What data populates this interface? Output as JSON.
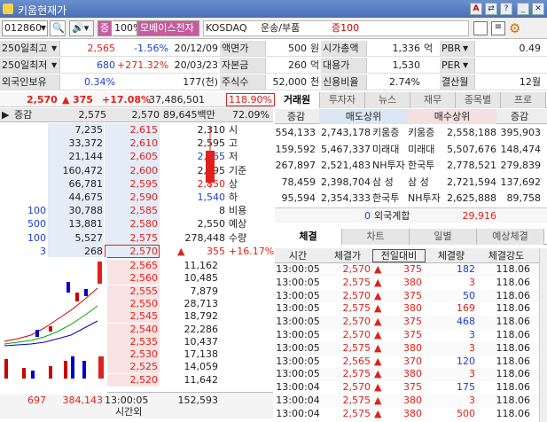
{
  "window": {
    "title": "키움현재가"
  },
  "toolbar": {
    "code": "012860",
    "pct": "100%",
    "name": "모베이스전자",
    "market": "KOSDAQ",
    "sector": "운송/부품",
    "margin": "증100",
    "margin_icon": "증"
  },
  "summary": [
    {
      "label": "250일최고",
      "v1": "2,565",
      "v2": "-1.56%",
      "v3": "20/12/09",
      "k2": "액면가",
      "v4": "500",
      "u4": "원",
      "k3": "시가총액",
      "v5": "1,336",
      "u5": "억",
      "k4": "PBR",
      "v6": "0.49"
    },
    {
      "label": "250일최저",
      "v1": "680",
      "v2": "+271.32%",
      "v3": "20/03/23",
      "k2": "자본금",
      "v4": "260",
      "u4": "억",
      "k3": "대용가",
      "v5": "1,530",
      "u5": "",
      "k4": "PER",
      "v6": ""
    },
    {
      "label": "외국인보유",
      "v1": "0.34%",
      "v2": "",
      "v3": "177(천)",
      "k2": "주식수",
      "v4": "52,000",
      "u4": "천",
      "k3": "신용비율",
      "v5": "2.74%",
      "u5": "",
      "k4": "결산월",
      "v6": "12월"
    }
  ],
  "price": {
    "cur": "2,570",
    "chg": "375",
    "rate": "+17.08%",
    "vol": "37,486,501",
    "ratio": "118.90%"
  },
  "ob_head": {
    "a": "증감",
    "b": "2,575",
    "c": "2,570",
    "d": "89,645백만",
    "e": "72.09%"
  },
  "asks": [
    {
      "q": "7,235",
      "p": "2,615",
      "i": "2,310",
      "il": "시"
    },
    {
      "q": "33,372",
      "p": "2,610",
      "i": "2,595",
      "il": "고"
    },
    {
      "q": "21,144",
      "p": "2,605",
      "i": "2,165",
      "il": "저"
    },
    {
      "q": "160,472",
      "p": "2,600",
      "i": "2,195",
      "il": "기준"
    },
    {
      "q": "66,781",
      "p": "2,595",
      "i": "2,850",
      "il": "상"
    },
    {
      "q": "44,675",
      "p": "2,590",
      "i": "1,540",
      "il": "하"
    },
    {
      "ch": "100",
      "q": "30,788",
      "p": "2,585",
      "i": "8",
      "il": "비용"
    },
    {
      "ch": "500",
      "q": "13,881",
      "p": "2,580",
      "i": "2,550",
      "il": "예상"
    },
    {
      "ch": "100",
      "q": "5,527",
      "p": "2,575",
      "i": "278,448",
      "il": "수량"
    },
    {
      "ch": "3",
      "q": "268",
      "p": "2,570",
      "i": "355",
      "il": "+16.17%"
    }
  ],
  "bids": [
    {
      "p": "2,565",
      "q": "11,162"
    },
    {
      "p": "2,560",
      "q": "10,485"
    },
    {
      "p": "2,555",
      "q": "7,879"
    },
    {
      "p": "2,550",
      "q": "28,713"
    },
    {
      "p": "2,545",
      "q": "18,792"
    },
    {
      "p": "2,540",
      "q": "22,286"
    },
    {
      "p": "2,535",
      "q": "10,437"
    },
    {
      "p": "2,530",
      "q": "17,138"
    },
    {
      "p": "2,525",
      "q": "14,059"
    },
    {
      "p": "2,520",
      "q": "11,642"
    }
  ],
  "ob_foot": {
    "a": "697",
    "b": "384,143",
    "c": "13:00:05",
    "d": "152,593",
    "e": "시간외"
  },
  "broker_tabs": [
    "거래원",
    "투자자",
    "뉴스",
    "재무",
    "종목별",
    "프로"
  ],
  "broker_head": {
    "a": "증감",
    "b": "매도상위",
    "c": "매수상위",
    "d": "증감"
  },
  "brokers": [
    {
      "a": "554,133",
      "b": "2,743,178",
      "c": "키움증",
      "d": "키움증",
      "e": "2,558,188",
      "f": "395,903"
    },
    {
      "a": "159,592",
      "b": "5,467,337",
      "c": "미래대",
      "d": "미래대",
      "e": "5,507,676",
      "f": "148,474"
    },
    {
      "a": "267,897",
      "b": "2,521,483",
      "c": "NH투자",
      "d": "한국투",
      "e": "2,778,521",
      "f": "279,839"
    },
    {
      "a": "78,459",
      "b": "2,398,704",
      "c": "삼 성",
      "d": "삼 성",
      "e": "2,721,594",
      "f": "137,692"
    },
    {
      "a": "95,594",
      "b": "2,354,333",
      "c": "한국투",
      "d": "NH투자",
      "e": "2,625,888",
      "f": "89,758"
    }
  ],
  "foreign": {
    "a": "0",
    "label": "외국계합",
    "b": "29,916"
  },
  "trade_tabs": [
    "체결",
    "차트",
    "일별",
    "예상체결"
  ],
  "trade_head": [
    "시간",
    "체결가",
    "전일대비",
    "체결량",
    "체결강도"
  ],
  "trades": [
    {
      "t": "13:00:05",
      "p": "2,570",
      "d": "375",
      "v": "182",
      "s": "118.06",
      "vc": "blue"
    },
    {
      "t": "13:00:05",
      "p": "2,575",
      "d": "380",
      "v": "3",
      "s": "118.06",
      "vc": "red"
    },
    {
      "t": "13:00:05",
      "p": "2,570",
      "d": "375",
      "v": "50",
      "s": "118.06",
      "vc": "blue"
    },
    {
      "t": "13:00:05",
      "p": "2,575",
      "d": "380",
      "v": "169",
      "s": "118.06",
      "vc": "red"
    },
    {
      "t": "13:00:05",
      "p": "2,570",
      "d": "375",
      "v": "468",
      "s": "118.06",
      "vc": "blue"
    },
    {
      "t": "13:00:05",
      "p": "2,570",
      "d": "375",
      "v": "3",
      "s": "118.06",
      "vc": "blue"
    },
    {
      "t": "13:00:05",
      "p": "2,575",
      "d": "380",
      "v": "3",
      "s": "118.06",
      "vc": "red"
    },
    {
      "t": "13:00:05",
      "p": "2,565",
      "d": "370",
      "v": "120",
      "s": "118.06",
      "vc": "blue"
    },
    {
      "t": "13:00:05",
      "p": "2,575",
      "d": "380",
      "v": "3",
      "s": "118.06",
      "vc": "red"
    },
    {
      "t": "13:00:04",
      "p": "2,570",
      "d": "375",
      "v": "175",
      "s": "118.06",
      "vc": "blue"
    },
    {
      "t": "13:00:04",
      "p": "2,575",
      "d": "380",
      "v": "3",
      "s": "118.06",
      "vc": "red"
    },
    {
      "t": "13:00:04",
      "p": "2,575",
      "d": "380",
      "v": "500",
      "s": "118.06",
      "vc": "red"
    }
  ]
}
